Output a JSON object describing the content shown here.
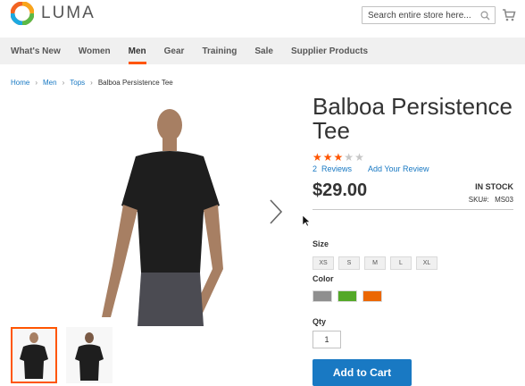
{
  "header": {
    "logo_text": "LUMA",
    "search_placeholder": "Search entire store here...",
    "icons": [
      "luma-logo-icon",
      "search-icon",
      "cart-icon"
    ]
  },
  "nav": {
    "items": [
      {
        "label": "What's New"
      },
      {
        "label": "Women"
      },
      {
        "label": "Men"
      },
      {
        "label": "Gear"
      },
      {
        "label": "Training"
      },
      {
        "label": "Sale"
      },
      {
        "label": "Supplier Products"
      }
    ],
    "active": "Men"
  },
  "breadcrumbs": {
    "items": [
      "Home",
      "Men",
      "Tops"
    ],
    "current": "Balboa Persistence Tee"
  },
  "product": {
    "title": "Balboa Persistence Tee",
    "rating": 3,
    "rating_max": 5,
    "review_count_label": "2  Reviews",
    "add_review_label": "Add Your Review",
    "price": "$29.00",
    "stock": "IN STOCK",
    "sku_label": "SKU#:",
    "sku": "MS03",
    "size_label": "Size",
    "sizes": [
      "XS",
      "S",
      "M",
      "L",
      "XL"
    ],
    "color_label": "Color",
    "colors": [
      "#8f8f8f",
      "#53a828",
      "#eb6703"
    ],
    "qty_label": "Qty",
    "qty": "1",
    "add_to_cart_label": "Add to Cart"
  },
  "colors": {
    "accent": "#ff5501",
    "link": "#1979c3",
    "star_on": "#ff5501",
    "star_off": "#c7c7c7"
  }
}
